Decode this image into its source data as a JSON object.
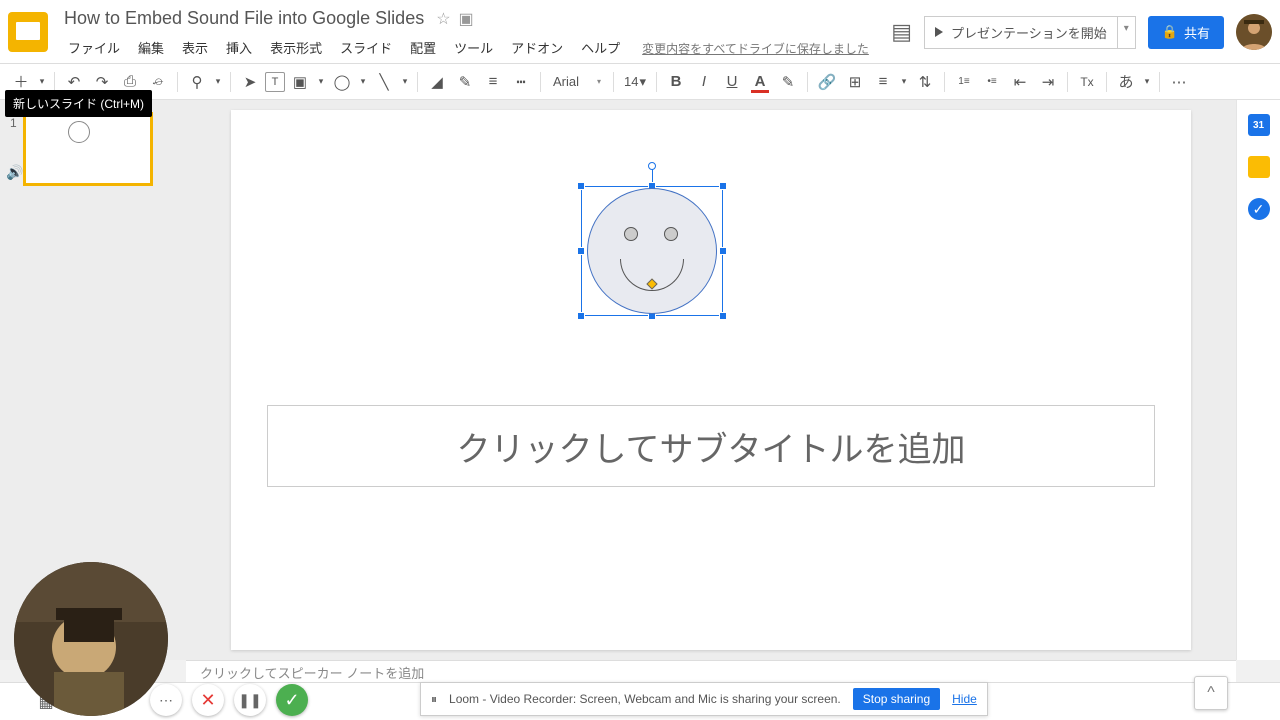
{
  "doc": {
    "title": "How to Embed Sound File into Google Slides"
  },
  "menu": {
    "file": "ファイル",
    "edit": "編集",
    "view": "表示",
    "insert": "挿入",
    "format": "表示形式",
    "slide": "スライド",
    "arrange": "配置",
    "tools": "ツール",
    "addons": "アドオン",
    "help": "ヘルプ"
  },
  "save_status": "変更内容をすべてドライブに保存しました",
  "present_label": "プレゼンテーションを開始",
  "share_label": "共有",
  "tooltip": "新しいスライド (Ctrl+M)",
  "toolbar": {
    "font": "Arial",
    "font_caret": "▾",
    "size": "14",
    "size_caret": "▾",
    "new_slide": "＋",
    "undo": "↶",
    "redo": "↷",
    "print": "⎙",
    "paint": "⌮",
    "zoom": "⚲",
    "select": "➤",
    "textbox": "T",
    "image": "▣",
    "shape": "◯",
    "line": "╲",
    "fill": "◢",
    "border_color": "✎",
    "border_weight": "≡",
    "border_dash": "┅",
    "bold": "B",
    "italic": "I",
    "underline": "U",
    "text_color": "A",
    "highlight": "✎",
    "link": "🔗",
    "comment_add": "⊞",
    "align": "≡",
    "line_spacing": "⇅",
    "num_list": "1≡",
    "bul_list": "•≡",
    "indent_dec": "⇤",
    "indent_inc": "⇥",
    "clear_format": "Tx",
    "input_tools": "あ",
    "more": "⋯"
  },
  "filmstrip": {
    "slide_num": "1"
  },
  "canvas": {
    "subtitle_placeholder": "クリックしてサブタイトルを追加"
  },
  "notes": {
    "placeholder": "クリックしてスピーカー ノートを追加"
  },
  "rail": {
    "cal": "31"
  },
  "banner": {
    "pause": "⏸",
    "text": "Loom - Video Recorder: Screen, Webcam and Mic is sharing your screen.",
    "stop": "Stop sharing",
    "hide": "Hide"
  },
  "loom": {
    "more": "⋯",
    "close": "✕",
    "pause": "❚❚",
    "check": "✓"
  },
  "explore": "^"
}
